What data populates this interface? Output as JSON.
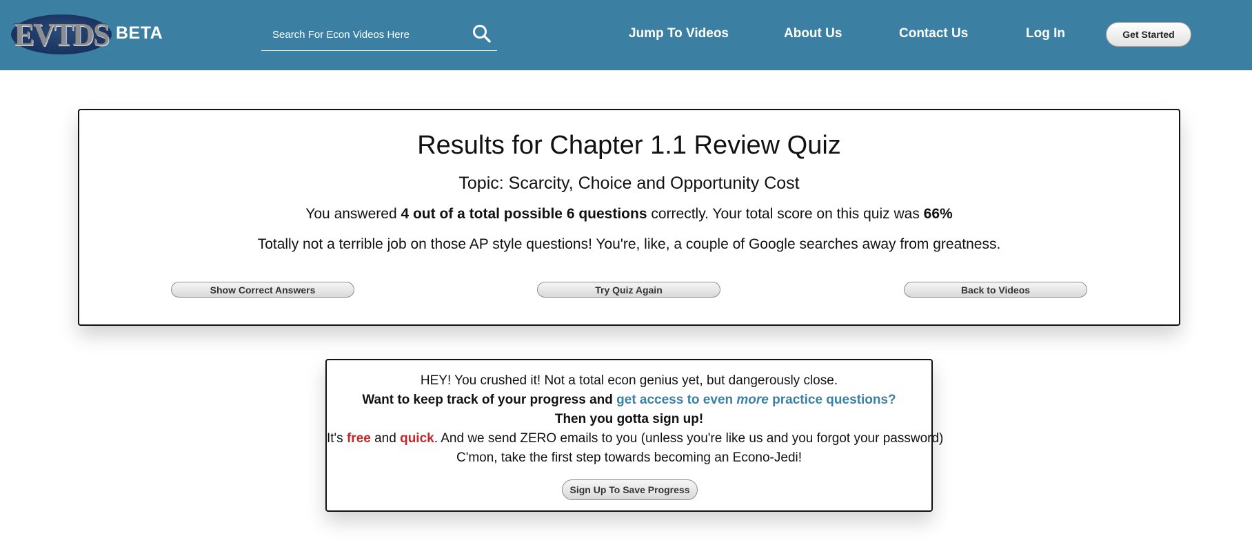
{
  "header": {
    "logo_text": "EVTDS",
    "beta_label": "BETA",
    "search_placeholder": "Search For Econ Videos Here",
    "nav": {
      "jump": "Jump To Videos",
      "about": "About Us",
      "contact": "Contact Us",
      "login": "Log In"
    },
    "get_started": "Get Started",
    "bar_color": "#3b7fa3"
  },
  "results": {
    "title": "Results for Chapter 1.1 Review Quiz",
    "topic": "Topic: Scarcity, Choice and Opportunity Cost",
    "score_prefix": "You answered ",
    "score_bold": "4 out of a total possible 6 questions",
    "score_mid": " correctly. Your total score on this quiz was ",
    "score_percent": "66%",
    "comment": "Totally not a terrible job on those AP style questions! You're, like, a couple of Google searches away from greatness.",
    "buttons": {
      "show_answers": "Show Correct Answers",
      "try_again": "Try Quiz Again",
      "back": "Back to Videos"
    }
  },
  "signup": {
    "line1": "HEY! You crushed it! Not a total econ genius yet, but dangerously close.",
    "line2_bold": "Want to keep track of your progress and ",
    "line2_link_a": "get access to even ",
    "line2_link_em": "more",
    "line2_link_b": " practice questions?",
    "line3": "Then you gotta sign up!",
    "line4_a": "It's ",
    "line4_free": "free",
    "line4_b": " and ",
    "line4_quick": "quick",
    "line4_c": ". And we send ZERO emails to you (unless you're like us and you forgot your password)",
    "line5": "C'mon, take the first step towards becoming an Econo-Jedi!",
    "button": "Sign Up To Save Progress",
    "link_color": "#3b7fa3",
    "accent_red": "#c0292b"
  }
}
